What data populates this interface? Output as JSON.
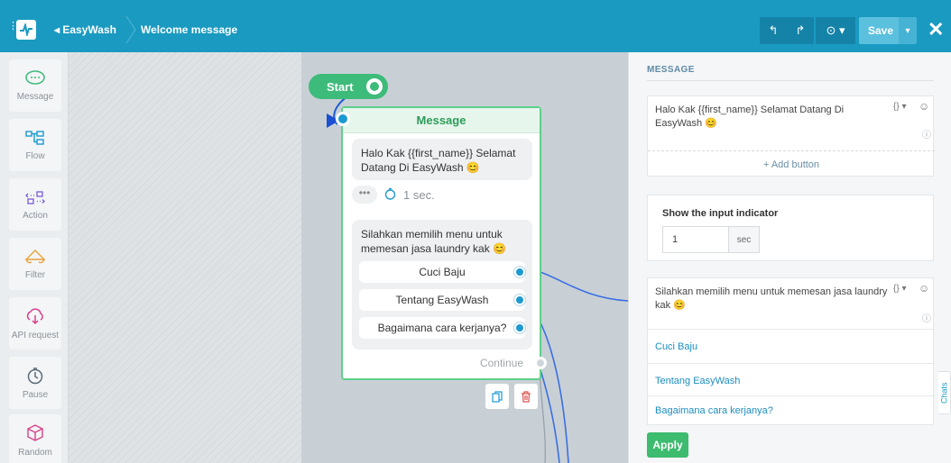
{
  "header": {
    "back_label": "EasyWash",
    "page_title": "Welcome message",
    "save_label": "Save"
  },
  "sidebar": {
    "items": [
      {
        "label": "Message",
        "icon": "chat-bubble-icon"
      },
      {
        "label": "Flow",
        "icon": "flow-icon"
      },
      {
        "label": "Action",
        "icon": "action-icon"
      },
      {
        "label": "Filter",
        "icon": "filter-icon"
      },
      {
        "label": "API request",
        "icon": "api-cloud-icon"
      },
      {
        "label": "Pause",
        "icon": "timer-icon"
      },
      {
        "label": "Random",
        "icon": "dice-icon"
      }
    ]
  },
  "canvas": {
    "start_label": "Start",
    "node": {
      "title": "Message",
      "bubble1": "Halo Kak {{first_name}} Selamat Datang Di EasyWash 😊",
      "typing_dots": "•••",
      "typing_delay": "1 sec.",
      "bubble2": "Silahkan memilih menu untuk memesan jasa laundry kak 😊",
      "buttons": [
        "Cuci Baju",
        "Tentang EasyWash",
        "Bagaimana cara kerjanya?"
      ],
      "continue_label": "Continue"
    }
  },
  "panel": {
    "section_title": "MESSAGE",
    "message1_text": "Halo Kak {{first_name}} Selamat Datang Di EasyWash 😊",
    "add_button_label": "+ Add button",
    "indicator_title": "Show the input indicator",
    "indicator_value": "1",
    "indicator_unit": "sec",
    "message2_text": "Silahkan memilih menu untuk memesan jasa laundry kak 😊",
    "buttons": [
      "Cuci Baju",
      "Tentang EasyWash",
      "Bagaimana cara kerjanya?"
    ],
    "apply_label": "Apply",
    "var_control": "{} ▾",
    "chats_tab": "Chats"
  },
  "colors": {
    "header": "#1a9ac0",
    "accent_green": "#3dbb7a",
    "link_blue": "#1c8dbf"
  }
}
